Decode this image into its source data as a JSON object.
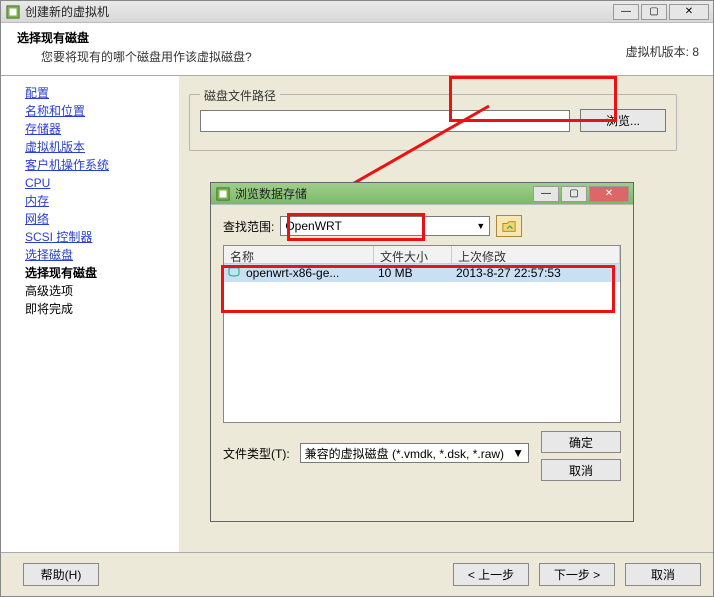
{
  "main_window": {
    "title": "创建新的虚拟机",
    "header": {
      "title": "选择现有磁盘",
      "subtitle": "您要将现有的哪个磁盘用作该虚拟磁盘?",
      "version_label": "虚拟机版本: 8"
    },
    "sidebar": {
      "items": [
        {
          "label": "配置",
          "type": "link"
        },
        {
          "label": "名称和位置",
          "type": "link"
        },
        {
          "label": "存储器",
          "type": "link"
        },
        {
          "label": "虚拟机版本",
          "type": "link"
        },
        {
          "label": "客户机操作系统",
          "type": "link"
        },
        {
          "label": "CPU",
          "type": "link"
        },
        {
          "label": "内存",
          "type": "link"
        },
        {
          "label": "网络",
          "type": "link"
        },
        {
          "label": "SCSI 控制器",
          "type": "link"
        },
        {
          "label": "选择磁盘",
          "type": "link"
        },
        {
          "label": "选择现有磁盘",
          "type": "current"
        },
        {
          "label": "高级选项",
          "type": "plain"
        },
        {
          "label": "即将完成",
          "type": "plain"
        }
      ]
    },
    "content": {
      "group_legend": "磁盘文件路径",
      "browse_label": "浏览..."
    },
    "footer": {
      "help": "帮助(H)",
      "back": "< 上一步",
      "next": "下一步 >",
      "cancel": "取消"
    }
  },
  "browse_dialog": {
    "title": "浏览数据存储",
    "lookin_label": "查找范围:",
    "lookin_value": "OpenWRT",
    "columns": {
      "name": "名称",
      "size": "文件大小",
      "modified": "上次修改"
    },
    "rows": [
      {
        "name": "openwrt-x86-ge...",
        "size": "10 MB",
        "modified": "2013-8-27 22:57:53"
      }
    ],
    "type_label": "文件类型(T):",
    "type_value": "兼容的虚拟磁盘 (*.vmdk, *.dsk, *.raw)",
    "ok": "确定",
    "cancel": "取消"
  }
}
